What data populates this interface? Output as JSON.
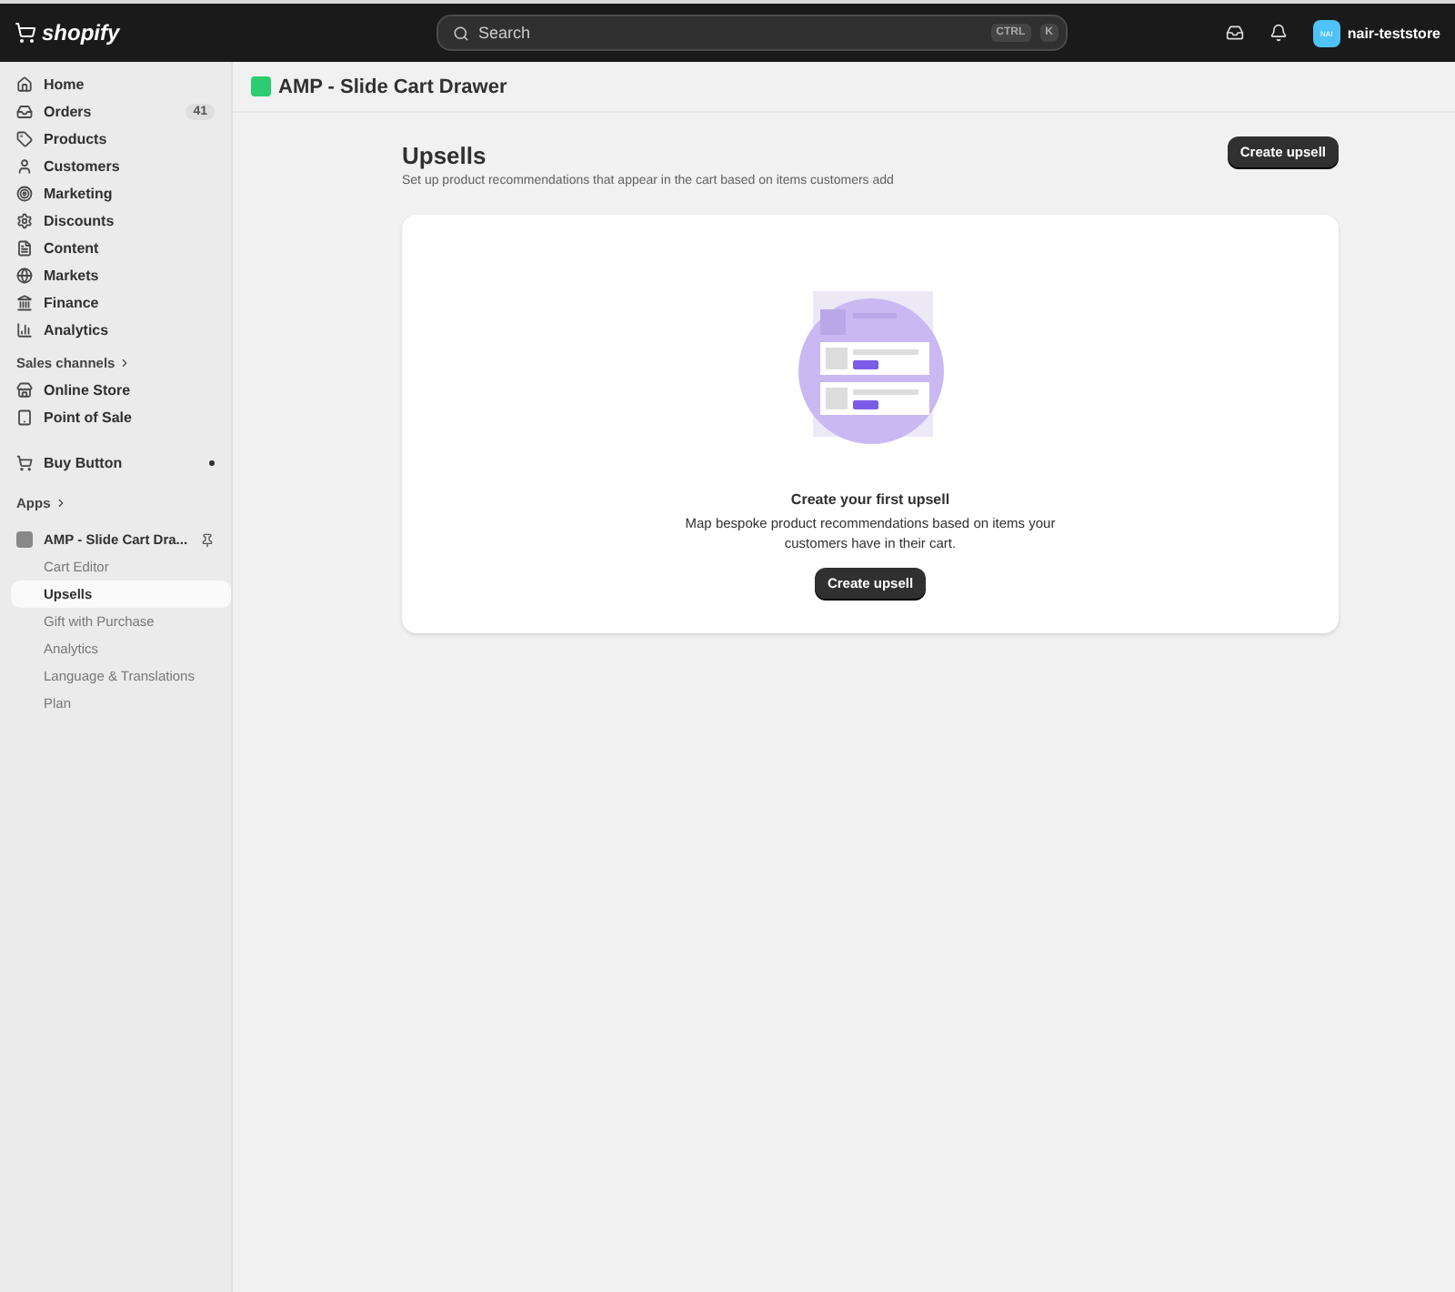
{
  "topbar": {
    "logo": "shopify",
    "search": {
      "placeholder": "Search",
      "keys": [
        "CTRL",
        "K"
      ]
    },
    "avatar": "NAI",
    "store": "nair-teststore"
  },
  "sidebar": {
    "items": [
      {
        "label": "Home"
      },
      {
        "label": "Orders",
        "badge": "41"
      },
      {
        "label": "Products"
      },
      {
        "label": "Customers"
      },
      {
        "label": "Marketing"
      },
      {
        "label": "Discounts"
      },
      {
        "label": "Content"
      },
      {
        "label": "Markets"
      },
      {
        "label": "Finance"
      },
      {
        "label": "Analytics"
      }
    ],
    "sales_channels": {
      "heading": "Sales channels",
      "items": [
        {
          "label": "Online Store"
        },
        {
          "label": "Point of Sale"
        }
      ]
    },
    "extra": [
      {
        "label": "Buy Button"
      }
    ],
    "apps": {
      "heading": "Apps",
      "app": {
        "label": "AMP - Slide Cart Dra...",
        "children": [
          {
            "label": "Cart Editor",
            "selected": false
          },
          {
            "label": "Upsells",
            "selected": true
          },
          {
            "label": "Gift with Purchase",
            "selected": false
          },
          {
            "label": "Analytics",
            "selected": false
          },
          {
            "label": "Language & Translations",
            "selected": false
          },
          {
            "label": "Plan",
            "selected": false
          }
        ]
      }
    }
  },
  "app_title": "AMP - Slide Cart Drawer",
  "page": {
    "title": "Upsells",
    "subtitle": "Set up product recommendations that appear in the cart based on items customers add",
    "primary_button": "Create upsell",
    "empty_state": {
      "heading": "Create your first upsell",
      "text": "Map bespoke product recommendations based on items your customers have in their cart.",
      "button": "Create upsell"
    }
  }
}
